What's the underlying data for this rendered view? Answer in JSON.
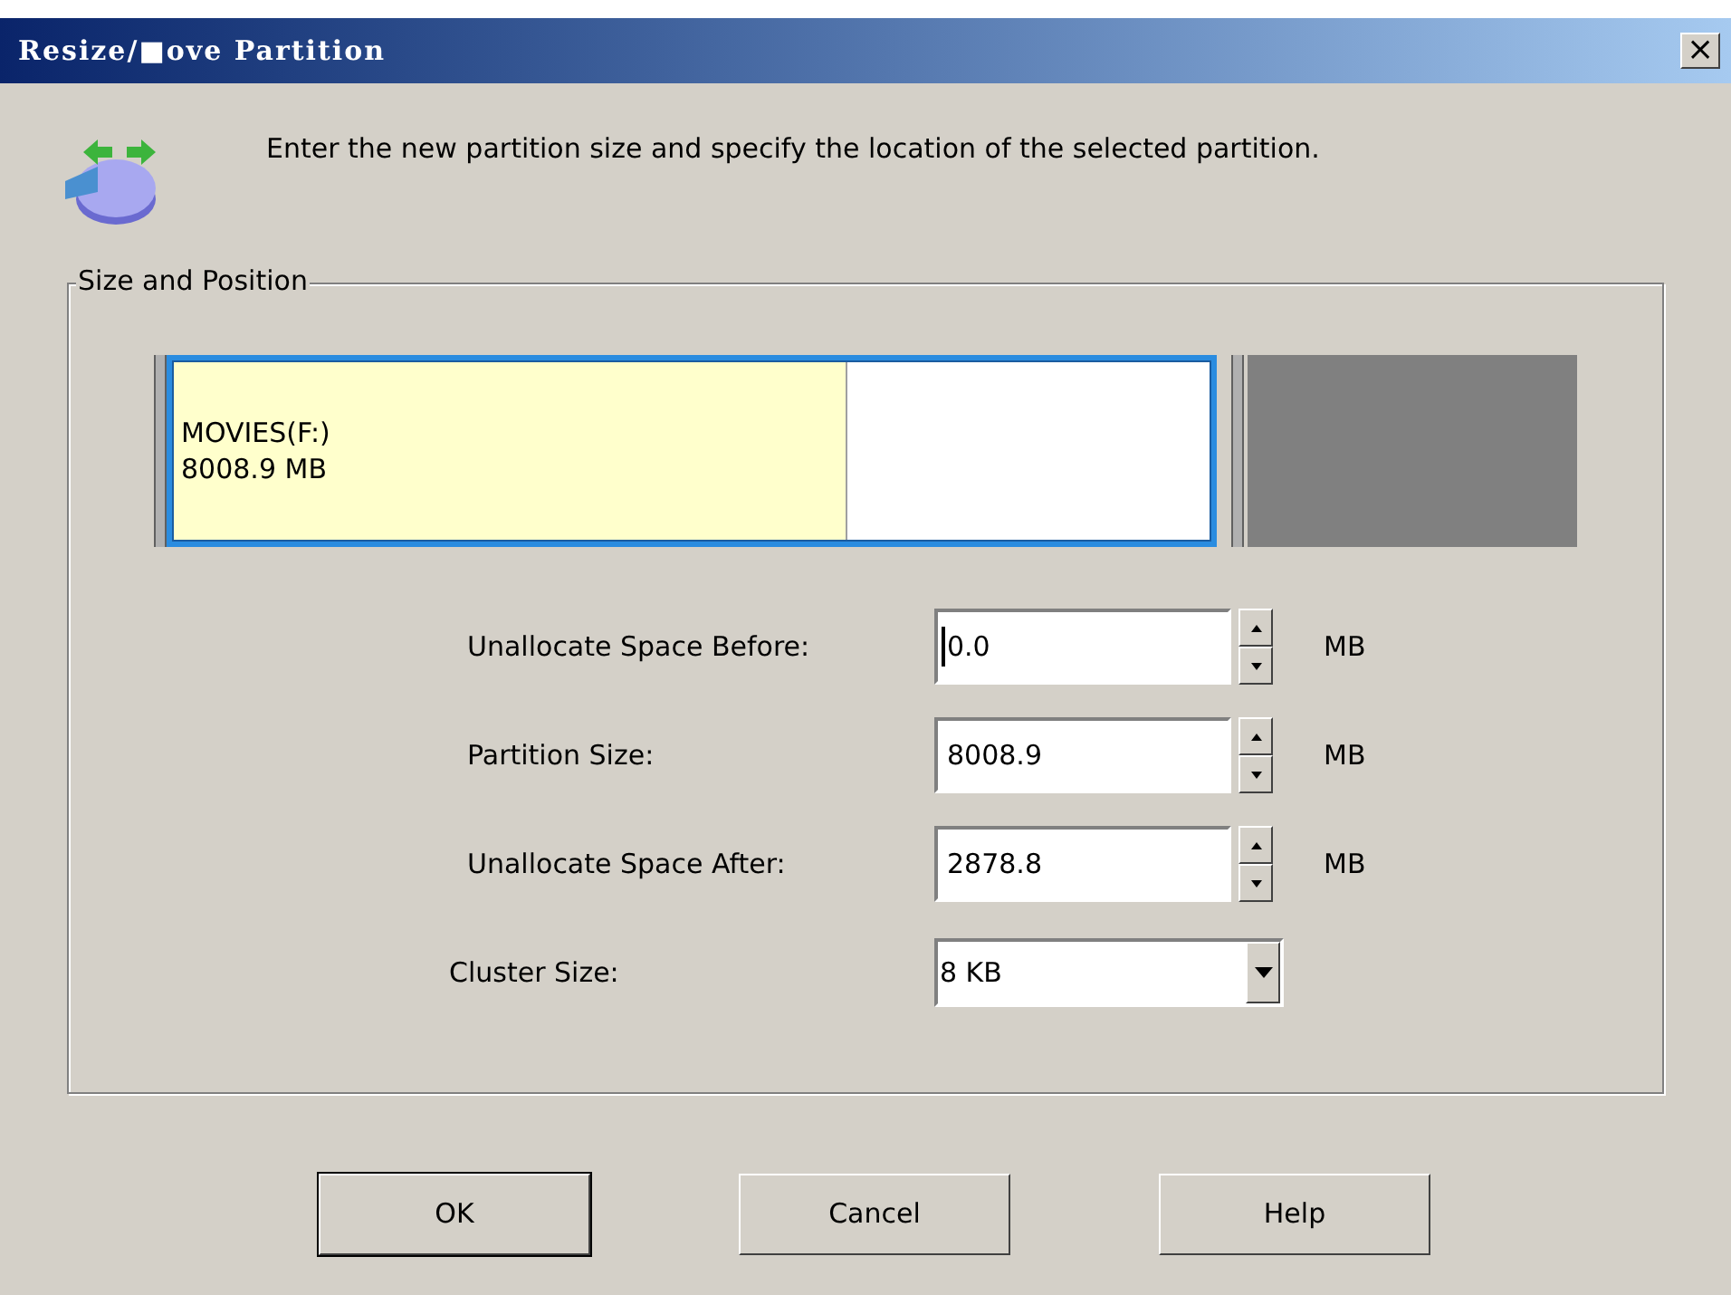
{
  "window": {
    "title": "Resize/■ove Partition",
    "close": "×"
  },
  "instruction": "Enter the new partition size and specify the location of the selected partition.",
  "group": {
    "title": "Size and Position",
    "partition_map": {
      "label": "MOVIES(F:)",
      "size": "8008.9 MB",
      "level": 0.65,
      "selected": true
    },
    "fields": [
      {
        "kind": "spin",
        "label": "Unallocate Space Before:",
        "value": "0.0",
        "unit": "MB",
        "focused": true
      },
      {
        "kind": "spin",
        "label": "Partition Size:",
        "value": "8008.9",
        "unit": "MB",
        "focused": false
      },
      {
        "kind": "spin",
        "label": "Unallocate Space After:",
        "value": "2878.8",
        "unit": "MB",
        "focused": false
      },
      {
        "kind": "dropdown",
        "label": "Cluster Size:",
        "value": "8 KB",
        "focused": false
      }
    ]
  },
  "buttons": [
    {
      "label": "OK",
      "default": true
    },
    {
      "label": "Cancel",
      "default": false
    },
    {
      "label": "Help",
      "default": false
    }
  ]
}
